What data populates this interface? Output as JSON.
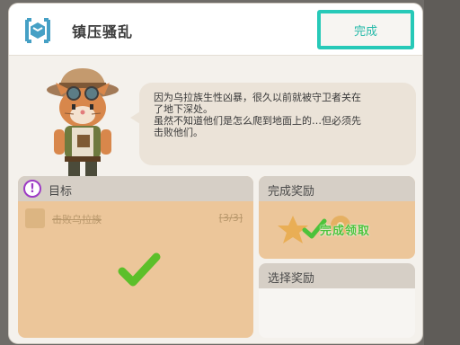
{
  "header": {
    "title": "镇压骚乱",
    "complete_button": "完成"
  },
  "dialog": {
    "line1": "因为乌拉族生性凶暴，很久以前就被守卫者关在",
    "line2": "了地下深处。",
    "line3": "虽然不知道他们是怎么爬到地面上的…但必须先",
    "line4": "击败他们。"
  },
  "goal": {
    "label": "目标",
    "icon_glyph": "!",
    "task": "击败乌拉族",
    "count": "[3/3]"
  },
  "reward": {
    "label": "完成奖励",
    "claim": "完成领取"
  },
  "select_reward": {
    "label": "选择奖励"
  },
  "colors": {
    "accent": "#27c9b8",
    "goal_icon": "#9d3bc5",
    "claim_green": "#4cc23a",
    "card_bg": "#ecc69a"
  }
}
